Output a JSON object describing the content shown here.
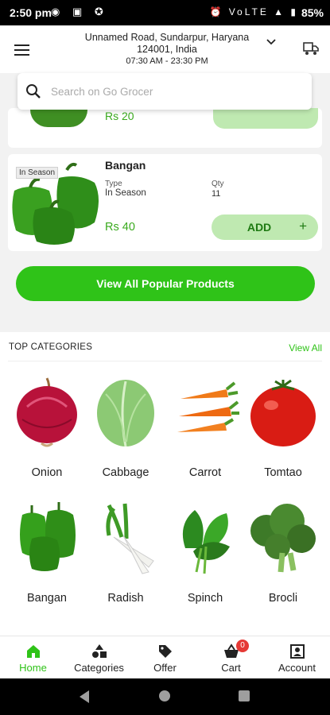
{
  "status_bar": {
    "time": "2:50",
    "time_suffix": "pm",
    "battery": "85%",
    "left_icons": "◉ ▣ ✪",
    "right_icons": "⏰ VoLTE ▲ ▮"
  },
  "header": {
    "address_line1": "Unnamed Road, Sundarpur, Haryana",
    "address_line2": "124001, India",
    "hours": "07:30 AM - 23:30 PM"
  },
  "search": {
    "placeholder": "Search on Go Grocer"
  },
  "previous_product": {
    "price": "Rs 20"
  },
  "product": {
    "name": "Bangan",
    "badge": "In Season",
    "type_label": "Type",
    "type_value": "In Season",
    "qty_label": "Qty",
    "qty_value": "11",
    "price": "Rs 40",
    "add_label": "ADD",
    "plus": "+"
  },
  "view_all_popular": "View All Popular Products",
  "top_categories": {
    "title": "TOP CATEGORIES",
    "view_all": "View All",
    "items": [
      {
        "name": "Onion",
        "icon": "onion-icon"
      },
      {
        "name": "Cabbage",
        "icon": "cabbage-icon"
      },
      {
        "name": "Carrot",
        "icon": "carrot-icon"
      },
      {
        "name": "Tomtao",
        "icon": "tomato-icon"
      },
      {
        "name": "Bangan",
        "icon": "capsicum-icon"
      },
      {
        "name": "Radish",
        "icon": "radish-icon"
      },
      {
        "name": "Spinch",
        "icon": "spinach-icon"
      },
      {
        "name": "Brocli",
        "icon": "broccoli-icon"
      }
    ]
  },
  "bottom_nav": {
    "home": "Home",
    "categories": "Categories",
    "offer": "Offer",
    "cart": "Cart",
    "cart_count": "0",
    "account": "Account"
  },
  "colors": {
    "accent": "#2fc318",
    "add_button_bg": "#bfe9b1",
    "price_green": "#3aaa1e",
    "badge_red": "#e53935"
  }
}
